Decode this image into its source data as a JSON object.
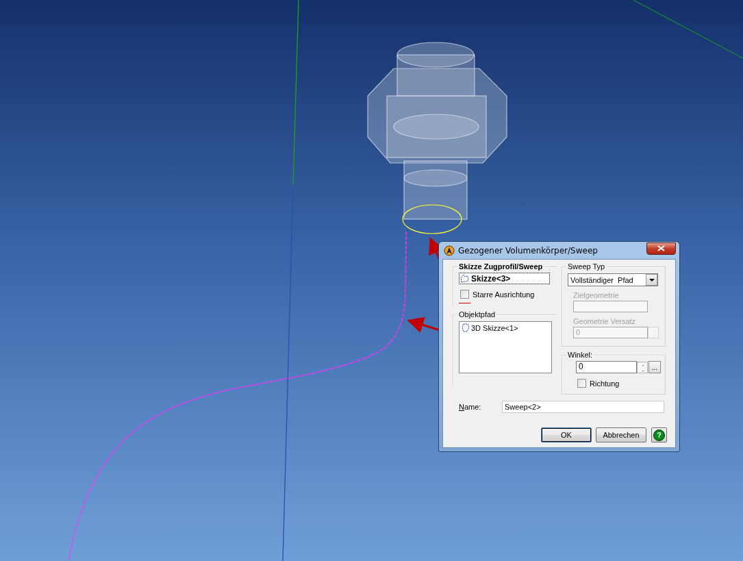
{
  "window": {
    "title": "Gezogener Volumenkörper/Sweep"
  },
  "profile_group": {
    "title": "Skizze Zugprofil/Sweep",
    "item": "Skizze<3>",
    "rigid": {
      "label": "Starre Ausrichtung",
      "checked": false
    }
  },
  "path_group": {
    "title": "Objektpfad",
    "items": [
      {
        "label": "3D Skizze<1>"
      }
    ]
  },
  "sweep_type": {
    "title": "Sweep Typ",
    "value": "Vollständiger  Pfad",
    "target_label": "Zielgeometrie",
    "offset_label": "Geometrie Versatz",
    "offset_value": "0",
    "disabled": true
  },
  "angle": {
    "title": "Winkel:",
    "value": "0",
    "more": "...",
    "direction": {
      "label": "Richtung",
      "checked": false
    }
  },
  "name": {
    "label": "Name:",
    "value": "Sweep<2>"
  },
  "buttons": [
    {
      "label": "OK",
      "kind": "default"
    },
    {
      "label": "Abbrechen",
      "kind": "normal"
    },
    {
      "label": "?",
      "kind": "help"
    }
  ]
}
